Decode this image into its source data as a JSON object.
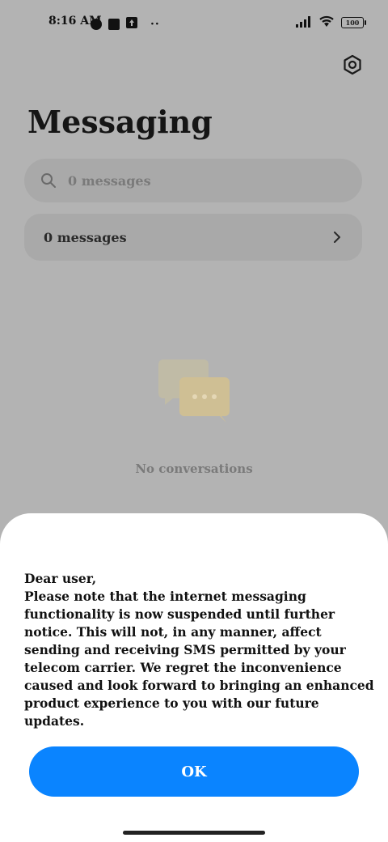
{
  "status_bar": {
    "time": "8:16 AM",
    "battery": "100"
  },
  "header": {
    "title": "Messaging"
  },
  "search": {
    "placeholder": "0 messages"
  },
  "messages_row": {
    "label": "0 messages"
  },
  "empty_state": {
    "text": "No conversations"
  },
  "dialog": {
    "greeting": "Dear user,",
    "body": "Please note that the internet messaging functionality is now suspended until further notice. This will not, in any manner, affect sending and receiving SMS permitted by your telecom carrier. We regret the inconvenience caused and look forward to bringing an enhanced product experience to you with our future updates.",
    "ok_label": "OK"
  },
  "colors": {
    "accent": "#0a84ff",
    "overlay": "#b3b3b3"
  }
}
